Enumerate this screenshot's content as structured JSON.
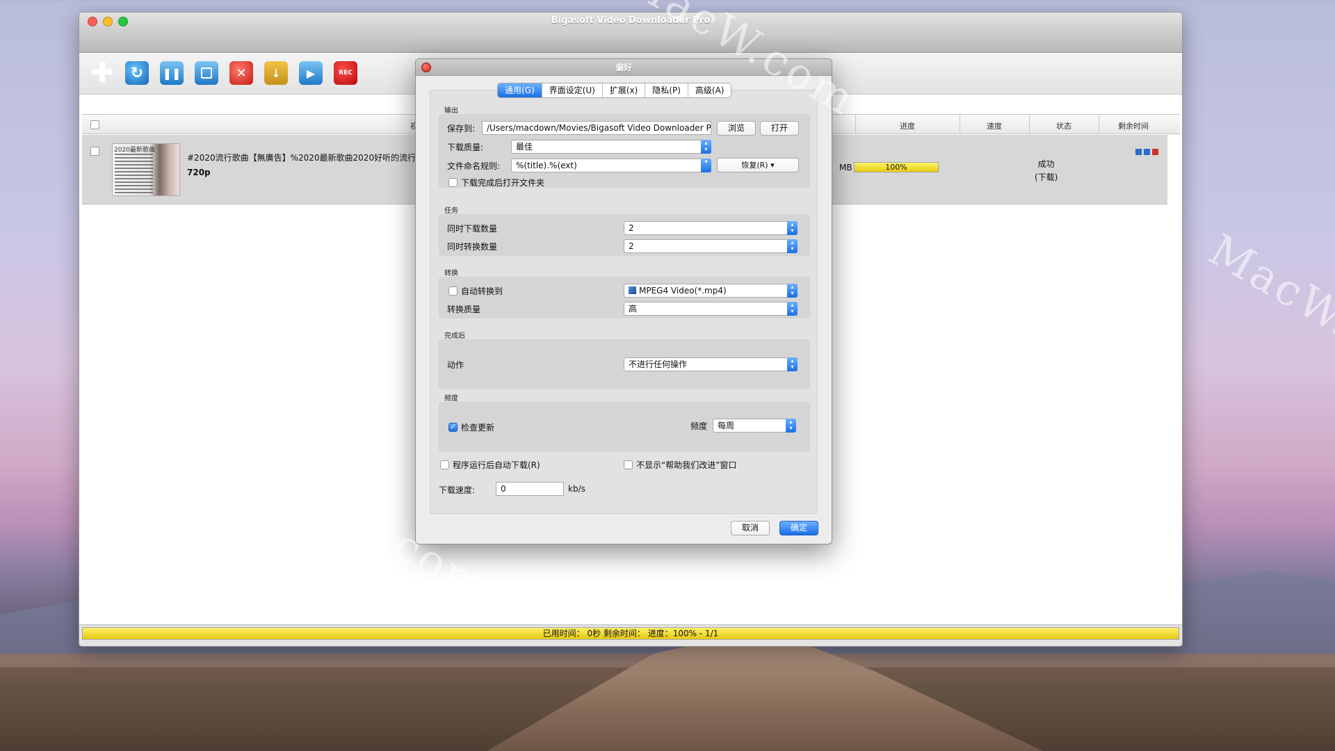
{
  "app": {
    "title": "Bigasoft Video Downloader Pro"
  },
  "toolbar": [
    {
      "name": "add-icon",
      "glyph": "✚"
    },
    {
      "name": "refresh-icon",
      "glyph": "↻"
    },
    {
      "name": "pause-icon",
      "glyph": "❚❚"
    },
    {
      "name": "stop-icon",
      "glyph": ""
    },
    {
      "name": "delete-icon",
      "glyph": "✕"
    },
    {
      "name": "folder-icon",
      "glyph": "↓"
    },
    {
      "name": "play-icon",
      "glyph": "▶"
    },
    {
      "name": "rec-icon",
      "glyph": "REC"
    }
  ],
  "list": {
    "headers": {
      "video": "视",
      "progress": "进度",
      "speed": "速度",
      "status": "状态",
      "remaining": "剩余时间"
    },
    "row": {
      "thumb_caption": "2020最新歌曲",
      "title": "#2020流行歌曲【無廣告】%2020最新歌曲2020好听的流行",
      "resolution": "720p",
      "size": "MB",
      "progress": "100%",
      "status_line1": "成功",
      "status_line2": "(下载)"
    }
  },
  "statusbar": {
    "text": "已用时间：  0秒 剩余时间：  进度：100% - 1/1"
  },
  "dialog": {
    "title": "偏好",
    "tabs": [
      "通用(G)",
      "界面设定(U)",
      "扩展(x)",
      "隐私(P)",
      "高级(A)"
    ],
    "output": {
      "section": "输出",
      "save_label": "保存到:",
      "save_path": "/Users/macdown/Movies/Bigasoft Video Downloader Pro",
      "browse": "浏览",
      "open": "打开",
      "quality_label": "下载质量:",
      "quality_value": "最佳",
      "naming_label": "文件命名规则:",
      "naming_value": "%(title).%(ext)",
      "restore": "恢复(R)",
      "open_folder": "下载完成后打开文件夹"
    },
    "task": {
      "section": "任务",
      "concurrent_dl_label": "同时下载数量",
      "concurrent_dl_value": "2",
      "concurrent_cv_label": "同时转换数量",
      "concurrent_cv_value": "2"
    },
    "convert": {
      "section": "转换",
      "auto_label": "自动转换到",
      "format_value": "MPEG4 Video(*.mp4)",
      "quality_label": "转换质量",
      "quality_value": "高"
    },
    "after": {
      "section": "完成后",
      "action_label": "动作",
      "action_value": "不进行任何操作"
    },
    "frequency": {
      "section": "频度",
      "check_update": "检查更新",
      "freq_label": "频度",
      "freq_value": "每周"
    },
    "misc": {
      "auto_download": "程序运行后自动下载(R)",
      "hide_help": "不显示“帮助我们改进”窗口",
      "speed_label": "下载速度:",
      "speed_value": "0",
      "speed_unit": "kb/s"
    },
    "cancel": "取消",
    "ok": "确定"
  },
  "watermark": "MacW.com"
}
